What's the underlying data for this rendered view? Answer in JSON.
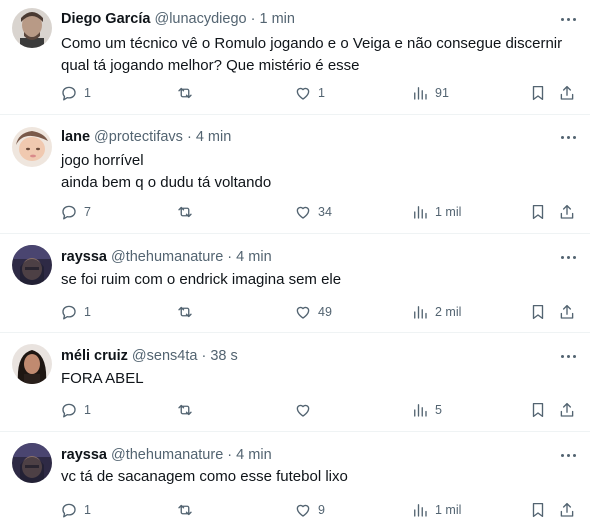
{
  "tweets": [
    {
      "name": "Diego García",
      "handle": "@lunacydiego",
      "time": "1 min",
      "lines": [
        "Como um técnico vê o Romulo jogando e o Veiga e não consegue discernir",
        "qual tá jogando melhor? Que mistério é esse"
      ],
      "replies": "1",
      "reposts": "",
      "likes": "1",
      "views": "91"
    },
    {
      "name": "lane",
      "handle": "@protectifavs",
      "time": "4 min",
      "lines": [
        "jogo horrível",
        "ainda bem q o dudu tá voltando"
      ],
      "replies": "7",
      "reposts": "",
      "likes": "34",
      "views": "1 mil"
    },
    {
      "name": "rayssa",
      "handle": "@thehumanature",
      "time": "4 min",
      "lines": [
        "se foi ruim com o endrick imagina sem ele"
      ],
      "replies": "1",
      "reposts": "",
      "likes": "49",
      "views": "2 mil"
    },
    {
      "name": "méli cruiz",
      "handle": "@sens4ta",
      "time": "38 s",
      "lines": [
        "FORA ABEL"
      ],
      "replies": "1",
      "reposts": "",
      "likes": "",
      "views": "5"
    },
    {
      "name": "rayssa",
      "handle": "@thehumanature",
      "time": "4 min",
      "lines": [
        "vc tá de sacanagem como esse futebol lixo"
      ],
      "replies": "1",
      "reposts": "",
      "likes": "9",
      "views": "1 mil"
    }
  ],
  "separator": "·",
  "icons": {
    "reply": "reply-icon",
    "repost": "repost-icon",
    "like": "heart-icon",
    "views": "views-icon",
    "bookmark": "bookmark-icon",
    "share": "share-icon",
    "more": "more-icon"
  },
  "colors": {
    "text": "#0f1419",
    "secondary": "#536471",
    "divider": "#eff3f4"
  }
}
